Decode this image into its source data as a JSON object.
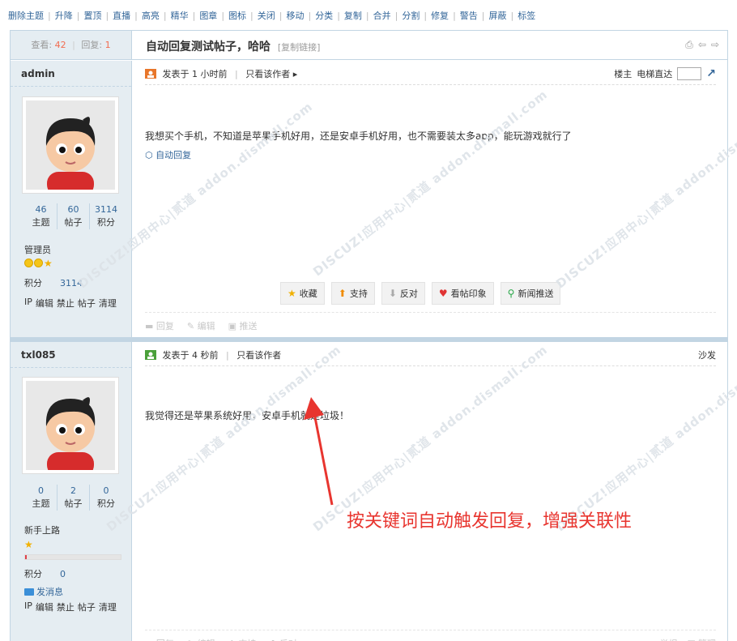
{
  "modbar": [
    "删除主题",
    "升降",
    "置顶",
    "直播",
    "高亮",
    "精华",
    "图章",
    "图标",
    "关闭",
    "移动",
    "分类",
    "复制",
    "合并",
    "分割",
    "修复",
    "警告",
    "屏蔽",
    "标签"
  ],
  "thread": {
    "views_label": "查看:",
    "views": "42",
    "replies_label": "回复:",
    "replies": "1",
    "title": "自动回复测试帖子，哈哈",
    "copy_link": "[复制链接]"
  },
  "posts": [
    {
      "author": "admin",
      "stats": [
        {
          "value": "46",
          "label": "主题"
        },
        {
          "value": "60",
          "label": "帖子"
        },
        {
          "value": "3114",
          "label": "积分"
        }
      ],
      "group": "管理员",
      "credit_label": "积分",
      "credit_value": "3114",
      "admin_links": [
        "IP",
        "编辑",
        "禁止",
        "帖子",
        "清理"
      ],
      "posted": "发表于 1 小时前",
      "only_author": "只看该作者 ▸",
      "floor": "楼主",
      "elevator": "电梯直达",
      "text": "我想买个手机，不知道是苹果手机好用，还是安卓手机好用，也不需要装太多app，能玩游戏就行了",
      "tag": "自动回复",
      "actions": [
        {
          "label": "收藏",
          "icon": "★",
          "color": "#f0b000"
        },
        {
          "label": "支持",
          "icon": "⬆",
          "color": "#f08b00"
        },
        {
          "label": "反对",
          "icon": "⬇",
          "color": "#aaaaaa"
        },
        {
          "label": "看帖印象",
          "icon": "♥",
          "color": "#e03434"
        },
        {
          "label": "新闻推送",
          "icon": "⚲",
          "color": "#2aa84a"
        }
      ],
      "footer": [
        "回复",
        "编辑",
        "推送"
      ]
    },
    {
      "author": "txl085",
      "stats": [
        {
          "value": "0",
          "label": "主题"
        },
        {
          "value": "2",
          "label": "帖子"
        },
        {
          "value": "0",
          "label": "积分"
        }
      ],
      "group": "新手上路",
      "progress": 0.01,
      "credit_label": "积分",
      "credit_value": "0",
      "pm": "发消息",
      "admin_links": [
        "IP",
        "编辑",
        "禁止",
        "帖子",
        "清理"
      ],
      "posted": "发表于 4 秒前",
      "only_author": "只看该作者",
      "floor": "沙发",
      "text": "我觉得还是苹果系统好用，安卓手机就是垃圾！",
      "footer": [
        "回复",
        "编辑",
        "支持",
        "反对"
      ],
      "footer_right": [
        "举报",
        "管理"
      ]
    }
  ],
  "annotation": "按关键词自动触发回复，增强关联性",
  "watermark_text": "DISCUZ!应用中心|贰道 addon.dismall.com"
}
